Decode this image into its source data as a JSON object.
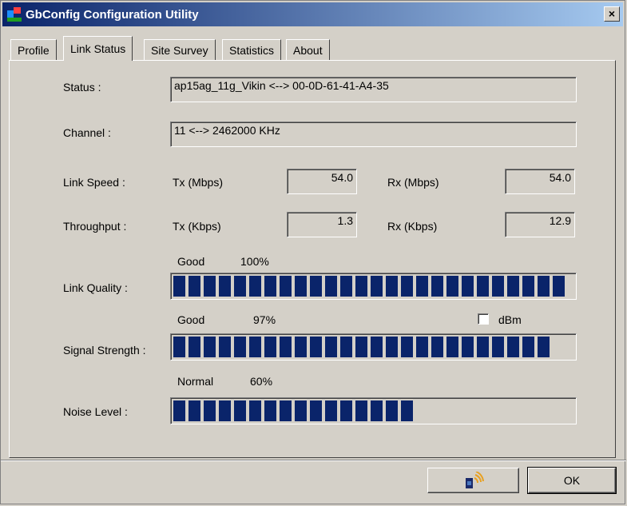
{
  "window": {
    "title": "GbConfig Configuration Utility",
    "close_label": "×"
  },
  "tabs": [
    {
      "label": "Profile",
      "active": false
    },
    {
      "label": "Link Status",
      "active": true
    },
    {
      "label": "Site Survey",
      "active": false
    },
    {
      "label": "Statistics",
      "active": false
    },
    {
      "label": "About",
      "active": false
    }
  ],
  "status": {
    "label": "Status :",
    "value": "ap15ag_11g_Vikin <--> 00-0D-61-41-A4-35"
  },
  "channel": {
    "label": "Channel :",
    "value": "11 <--> 2462000 KHz"
  },
  "link_speed": {
    "label": "Link Speed :",
    "tx_label": "Tx (Mbps)",
    "tx_value": "54.0",
    "rx_label": "Rx (Mbps)",
    "rx_value": "54.0"
  },
  "throughput": {
    "label": "Throughput :",
    "tx_label": "Tx (Kbps)",
    "tx_value": "1.3",
    "rx_label": "Rx (Kbps)",
    "rx_value": "12.9"
  },
  "link_quality": {
    "label": "Link Quality :",
    "rating": "Good",
    "percent_text": "100%",
    "level": 1.0
  },
  "signal_strength": {
    "label": "Signal Strength :",
    "rating": "Good",
    "percent_text": "97%",
    "level": 0.97,
    "dbm_label": "dBm",
    "dbm_checked": false
  },
  "noise_level": {
    "label": "Noise Level :",
    "rating": "Normal",
    "percent_text": "60%",
    "level": 0.6
  },
  "buttons": {
    "ok_label": "OK",
    "radio_icon": "wireless-card-icon"
  },
  "colors": {
    "bar": "#0a246a",
    "titlebar_start": "#0a246a",
    "titlebar_end": "#a6caf0"
  }
}
